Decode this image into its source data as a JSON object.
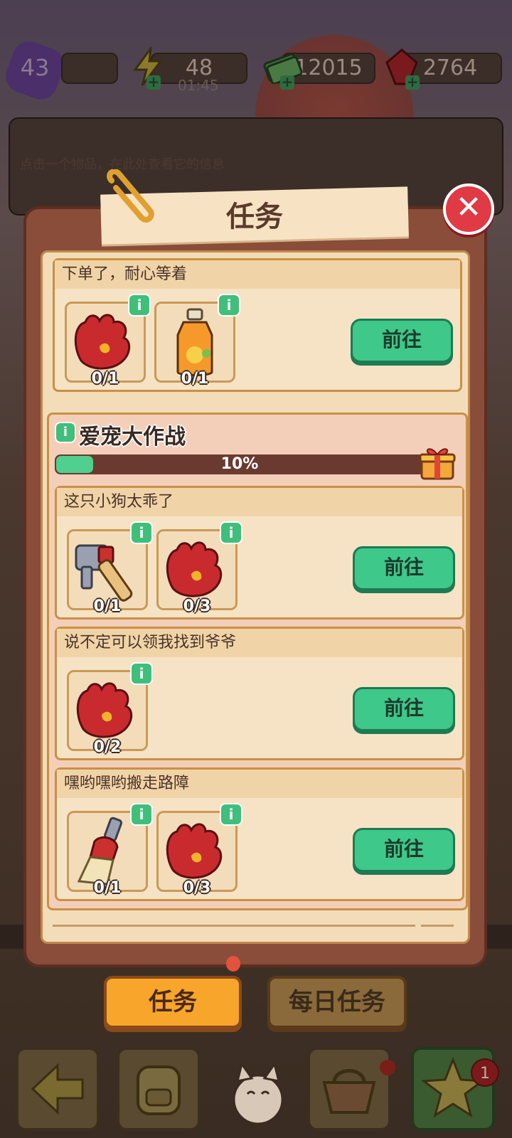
{
  "topbar": {
    "level": "43",
    "energy": "48",
    "energy_timer": "01:45",
    "cash": "12015",
    "gems": "2764"
  },
  "infobox": {
    "hint": "点击一个物品，在此处查看它的信息"
  },
  "panel": {
    "title": "任务",
    "close_icon": "close-icon"
  },
  "tasks": [
    {
      "title": "下单了，耐心等着",
      "items": [
        {
          "icon": "red-gloves-icon",
          "count": "0/1"
        },
        {
          "icon": "juice-bottle-icon",
          "count": "0/1"
        }
      ],
      "button": "前往"
    }
  ],
  "event": {
    "title": "爱宠大作战",
    "progress_label": "10%",
    "progress_fraction": 0.1,
    "tasks": [
      {
        "title": "这只小狗太乖了",
        "items": [
          {
            "icon": "hammer-icon",
            "count": "0/1"
          },
          {
            "icon": "red-gloves-icon",
            "count": "0/3"
          }
        ],
        "button": "前往"
      },
      {
        "title": "说不定可以领我找到爷爷",
        "items": [
          {
            "icon": "red-gloves-icon",
            "count": "0/2"
          }
        ],
        "button": "前往"
      },
      {
        "title": "嘿哟嘿哟搬走路障",
        "items": [
          {
            "icon": "brush-icon",
            "count": "0/1"
          },
          {
            "icon": "red-gloves-icon",
            "count": "0/3"
          }
        ],
        "button": "前往"
      }
    ]
  },
  "tabs": {
    "active": "任务",
    "inactive": "每日任务"
  },
  "bottom": {
    "badge": "1"
  },
  "colors": {
    "go_button": "#3ec88a",
    "info_badge": "#3fbf7a",
    "close_button": "#e03a45",
    "tab_active": "#f7a52b"
  }
}
